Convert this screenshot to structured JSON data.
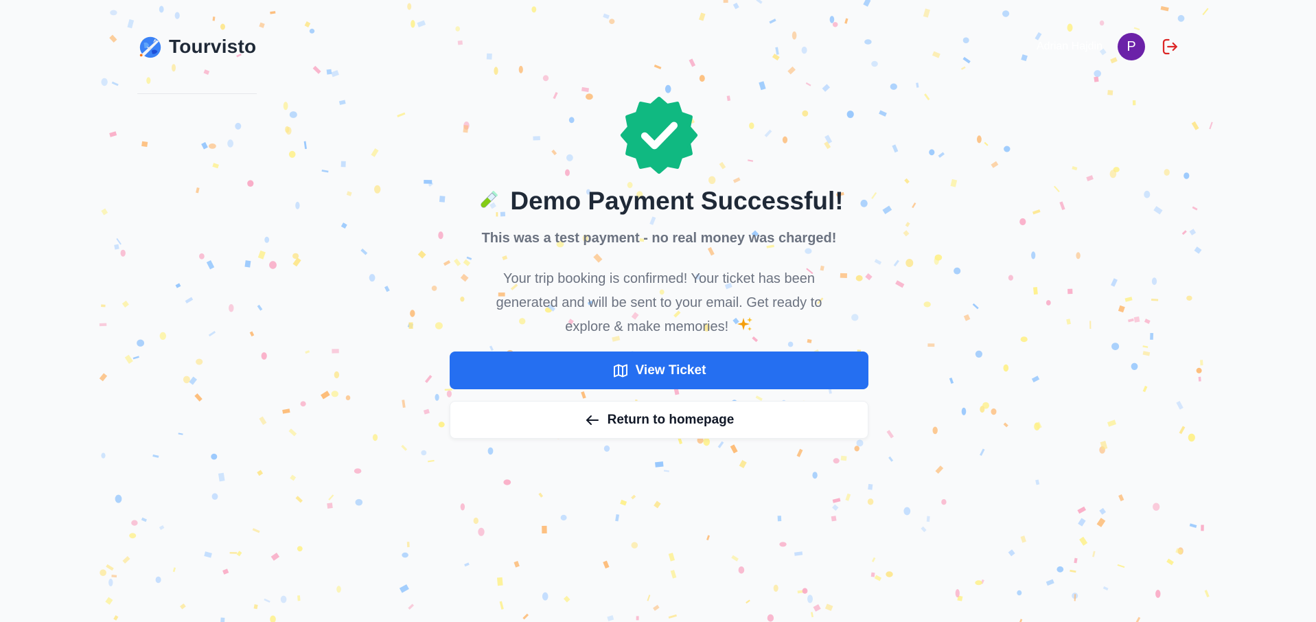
{
  "header": {
    "brand_name": "Tourvisto",
    "brand_icon": "globe-airplane-icon",
    "user_name": "Adrian Hajdin",
    "avatar_letter": "P",
    "avatar_color": "#6b21a8",
    "logout_icon": "logout-icon",
    "logout_color": "#dc2626"
  },
  "success": {
    "badge_icon": "verified-check-badge-icon",
    "badge_color": "#10b981",
    "title_emoji_icon": "test-tube-icon",
    "title": "Demo Payment Successful!",
    "subtitle": "This was a test payment - no real money was charged!",
    "message": "Your trip booking is confirmed! Your ticket has been generated and will be sent to your email. Get ready to explore & make memories!",
    "message_emoji_icon": "sparkles-icon"
  },
  "actions": {
    "view_ticket_label": "View Ticket",
    "view_ticket_icon": "map-icon",
    "primary_color": "#256ff1",
    "return_label": "Return to homepage",
    "return_icon": "arrow-left-icon"
  },
  "background": {
    "effect": "confetti",
    "confetti_colors": [
      "#f9a8c4",
      "#fde68a",
      "#bfdbfe",
      "#fdba74",
      "#fef08a",
      "#93c5fd"
    ]
  }
}
